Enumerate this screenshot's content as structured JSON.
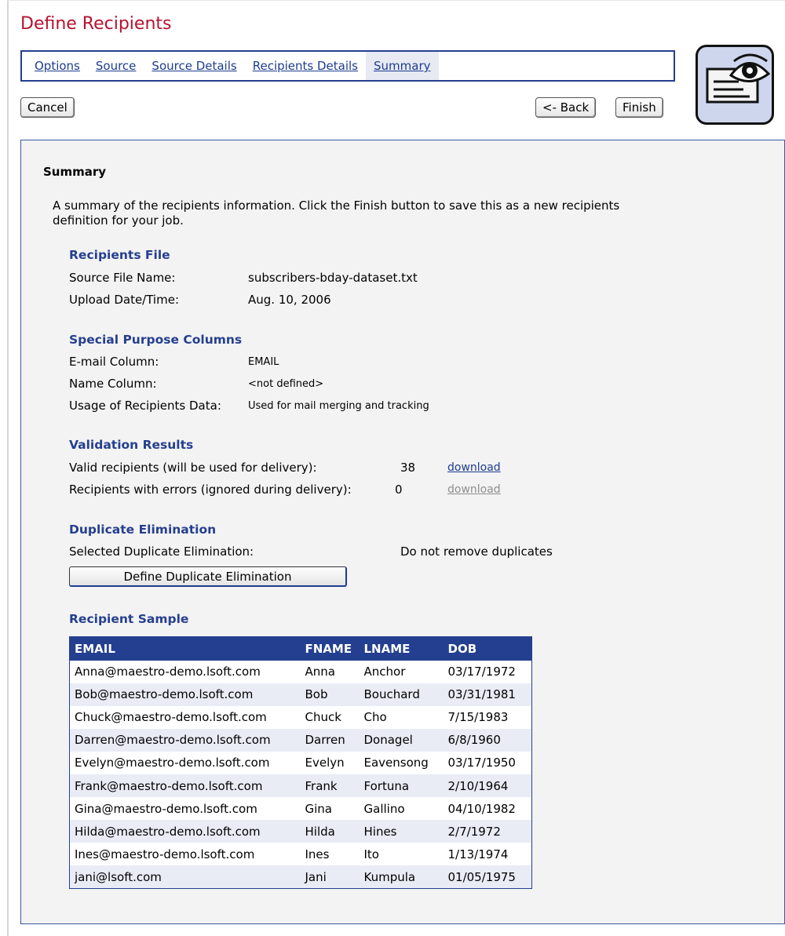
{
  "page": {
    "title": "Define Recipients"
  },
  "tabs": [
    {
      "label": "Options"
    },
    {
      "label": "Source"
    },
    {
      "label": "Source Details"
    },
    {
      "label": "Recipients Details"
    },
    {
      "label": "Summary"
    }
  ],
  "buttons": {
    "cancel": "Cancel",
    "back": "<- Back",
    "finish": "Finish",
    "define_dup": "Define Duplicate Elimination"
  },
  "summary": {
    "title": "Summary",
    "description_line1": "A summary of the recipients information. Click the Finish button to save this as a new recipients",
    "description_line2": "definition for your job."
  },
  "recipients_file": {
    "heading": "Recipients File",
    "source_label": "Source File Name:",
    "source_value": "subscribers-bday-dataset.txt",
    "upload_label": "Upload Date/Time:",
    "upload_value": "Aug. 10, 2006"
  },
  "special_columns": {
    "heading": "Special Purpose Columns",
    "email_label": "E-mail Column:",
    "email_value": "EMAIL",
    "name_label": "Name Column:",
    "name_value": "<not defined>",
    "usage_label": "Usage of Recipients Data:",
    "usage_value": "Used for mail merging and tracking"
  },
  "validation": {
    "heading": "Validation Results",
    "valid_label": "Valid recipients (will be used for delivery):",
    "valid_count": "38",
    "valid_link": "download",
    "errors_label": "Recipients with errors (ignored during delivery):",
    "errors_count": "0",
    "errors_link": "download"
  },
  "duplicates": {
    "heading": "Duplicate Elimination",
    "label": "Selected Duplicate Elimination:",
    "value": "Do not remove duplicates"
  },
  "sample": {
    "heading": "Recipient Sample",
    "columns": [
      "EMAIL",
      "FNAME",
      "LNAME",
      "DOB"
    ],
    "rows": [
      [
        "Anna@maestro-demo.lsoft.com",
        "Anna",
        "Anchor",
        "03/17/1972"
      ],
      [
        "Bob@maestro-demo.lsoft.com",
        "Bob",
        "Bouchard",
        "03/31/1981"
      ],
      [
        "Chuck@maestro-demo.lsoft.com",
        "Chuck",
        "Cho",
        "7/15/1983"
      ],
      [
        "Darren@maestro-demo.lsoft.com",
        "Darren",
        "Donagel",
        "6/8/1960"
      ],
      [
        "Evelyn@maestro-demo.lsoft.com",
        "Evelyn",
        "Eavensong",
        "03/17/1950"
      ],
      [
        "Frank@maestro-demo.lsoft.com",
        "Frank",
        "Fortuna",
        "2/10/1964"
      ],
      [
        "Gina@maestro-demo.lsoft.com",
        "Gina",
        "Gallino",
        "04/10/1982"
      ],
      [
        "Hilda@maestro-demo.lsoft.com",
        "Hilda",
        "Hines",
        "2/7/1972"
      ],
      [
        "Ines@maestro-demo.lsoft.com",
        "Ines",
        "Ito",
        "1/13/1974"
      ],
      [
        "jani@lsoft.com",
        "Jani",
        "Kumpula",
        "01/05/1975"
      ]
    ]
  },
  "colors": {
    "title": "#b5122e",
    "accent": "#243f8f",
    "panel": "#f3f3f3"
  },
  "icons": {
    "logo": "eye-document-icon"
  }
}
